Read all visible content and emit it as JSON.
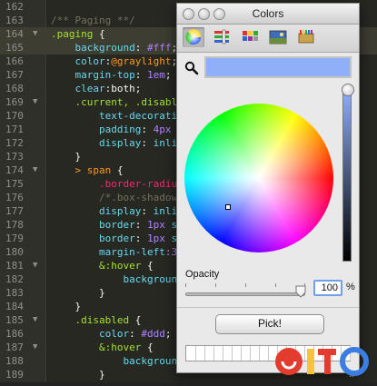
{
  "editor": {
    "lines": [
      {
        "num": "162",
        "fold": "",
        "hl": false,
        "tokens": []
      },
      {
        "num": "163",
        "fold": "",
        "hl": false,
        "tokens": [
          {
            "t": "/** Paging **/",
            "c": "c-com"
          }
        ]
      },
      {
        "num": "164",
        "fold": "▼",
        "hl": true,
        "tokens": [
          {
            "t": ".paging ",
            "c": "c-sel"
          },
          {
            "t": "{",
            "c": "c-plain"
          }
        ]
      },
      {
        "num": "165",
        "fold": "",
        "hl": true,
        "tokens": [
          {
            "t": "    background",
            "c": "c-prop"
          },
          {
            "t": ": ",
            "c": "c-plain"
          },
          {
            "t": "#fff",
            "c": "c-val"
          },
          {
            "t": ";",
            "c": "c-plain"
          }
        ]
      },
      {
        "num": "166",
        "fold": "",
        "hl": false,
        "tokens": [
          {
            "t": "    color",
            "c": "c-prop"
          },
          {
            "t": ":",
            "c": "c-plain"
          },
          {
            "t": "@graylight",
            "c": "c-var"
          },
          {
            "t": ";",
            "c": "c-plain"
          }
        ]
      },
      {
        "num": "167",
        "fold": "",
        "hl": false,
        "tokens": [
          {
            "t": "    margin-top",
            "c": "c-prop"
          },
          {
            "t": ": ",
            "c": "c-plain"
          },
          {
            "t": "1em",
            "c": "c-val"
          },
          {
            "t": ";",
            "c": "c-plain"
          }
        ]
      },
      {
        "num": "168",
        "fold": "",
        "hl": false,
        "tokens": [
          {
            "t": "    clear",
            "c": "c-prop"
          },
          {
            "t": ":both;",
            "c": "c-plain"
          }
        ]
      },
      {
        "num": "169",
        "fold": "▼",
        "hl": false,
        "tokens": [
          {
            "t": "    .current, .disable",
            "c": "c-sel"
          }
        ]
      },
      {
        "num": "170",
        "fold": "",
        "hl": false,
        "tokens": [
          {
            "t": "        text-decoratio",
            "c": "c-prop"
          }
        ]
      },
      {
        "num": "171",
        "fold": "",
        "hl": false,
        "tokens": [
          {
            "t": "        padding",
            "c": "c-prop"
          },
          {
            "t": ": ",
            "c": "c-plain"
          },
          {
            "t": "4px",
            "c": "c-val"
          }
        ]
      },
      {
        "num": "172",
        "fold": "",
        "hl": false,
        "tokens": [
          {
            "t": "        display",
            "c": "c-prop"
          },
          {
            "t": ": ",
            "c": "c-plain"
          },
          {
            "t": "inlin",
            "c": "c-prop"
          }
        ]
      },
      {
        "num": "173",
        "fold": "",
        "hl": false,
        "tokens": [
          {
            "t": "    }",
            "c": "c-plain"
          }
        ]
      },
      {
        "num": "174",
        "fold": "▼",
        "hl": false,
        "tokens": [
          {
            "t": "    ",
            "c": "c-plain"
          },
          {
            "t": "> span ",
            "c": "c-var"
          },
          {
            "t": "{",
            "c": "c-plain"
          }
        ]
      },
      {
        "num": "175",
        "fold": "",
        "hl": false,
        "tokens": [
          {
            "t": "        .border-radiu",
            "c": "c-tag"
          }
        ]
      },
      {
        "num": "176",
        "fold": "",
        "hl": false,
        "tokens": [
          {
            "t": "        /*.box-shadow",
            "c": "c-com"
          }
        ]
      },
      {
        "num": "177",
        "fold": "",
        "hl": false,
        "tokens": [
          {
            "t": "        display",
            "c": "c-prop"
          },
          {
            "t": ": ",
            "c": "c-plain"
          },
          {
            "t": "inli",
            "c": "c-prop"
          }
        ]
      },
      {
        "num": "178",
        "fold": "",
        "hl": false,
        "tokens": [
          {
            "t": "        border",
            "c": "c-prop"
          },
          {
            "t": ": ",
            "c": "c-plain"
          },
          {
            "t": "1px",
            "c": "c-val"
          },
          {
            "t": " s",
            "c": "c-prop"
          }
        ]
      },
      {
        "num": "179",
        "fold": "",
        "hl": false,
        "tokens": [
          {
            "t": "        border",
            "c": "c-prop"
          },
          {
            "t": ": ",
            "c": "c-plain"
          },
          {
            "t": "1px",
            "c": "c-val"
          },
          {
            "t": " s",
            "c": "c-prop"
          }
        ]
      },
      {
        "num": "180",
        "fold": "",
        "hl": false,
        "tokens": [
          {
            "t": "        margin-left",
            "c": "c-prop"
          },
          {
            "t": ":3",
            "c": "c-val"
          }
        ]
      },
      {
        "num": "181",
        "fold": "▼",
        "hl": false,
        "tokens": [
          {
            "t": "        &:hover ",
            "c": "c-sel"
          },
          {
            "t": "{",
            "c": "c-plain"
          }
        ]
      },
      {
        "num": "182",
        "fold": "",
        "hl": false,
        "tokens": [
          {
            "t": "            backgroun",
            "c": "c-prop"
          }
        ]
      },
      {
        "num": "183",
        "fold": "",
        "hl": false,
        "tokens": [
          {
            "t": "        }",
            "c": "c-plain"
          }
        ]
      },
      {
        "num": "184",
        "fold": "",
        "hl": false,
        "tokens": [
          {
            "t": "    }",
            "c": "c-plain"
          }
        ]
      },
      {
        "num": "185",
        "fold": "▼",
        "hl": false,
        "tokens": [
          {
            "t": "    .disabled ",
            "c": "c-sel"
          },
          {
            "t": "{",
            "c": "c-plain"
          }
        ]
      },
      {
        "num": "186",
        "fold": "",
        "hl": false,
        "tokens": [
          {
            "t": "        color",
            "c": "c-prop"
          },
          {
            "t": ": ",
            "c": "c-plain"
          },
          {
            "t": "#ddd",
            "c": "c-val"
          },
          {
            "t": ";",
            "c": "c-plain"
          }
        ]
      },
      {
        "num": "187",
        "fold": "▼",
        "hl": false,
        "tokens": [
          {
            "t": "        &:hover ",
            "c": "c-sel"
          },
          {
            "t": "{",
            "c": "c-plain"
          }
        ]
      },
      {
        "num": "188",
        "fold": "",
        "hl": false,
        "tokens": [
          {
            "t": "            backgroun",
            "c": "c-prop"
          }
        ]
      },
      {
        "num": "189",
        "fold": "",
        "hl": false,
        "tokens": [
          {
            "t": "        }",
            "c": "c-plain"
          }
        ]
      }
    ]
  },
  "colors_panel": {
    "title": "Colors",
    "toolbar_icons": [
      "color-wheel-icon",
      "color-sliders-icon",
      "color-palettes-icon",
      "image-palettes-icon",
      "crayons-icon"
    ],
    "selected_color": "#8fb0f9",
    "opacity_label": "Opacity",
    "opacity_value": "100",
    "opacity_unit": "%",
    "pick_button": "Pick!"
  },
  "watermark": {
    "text": "ITO",
    "colors": [
      "#e33b2e",
      "#f7c23c",
      "#3b7de0"
    ]
  }
}
